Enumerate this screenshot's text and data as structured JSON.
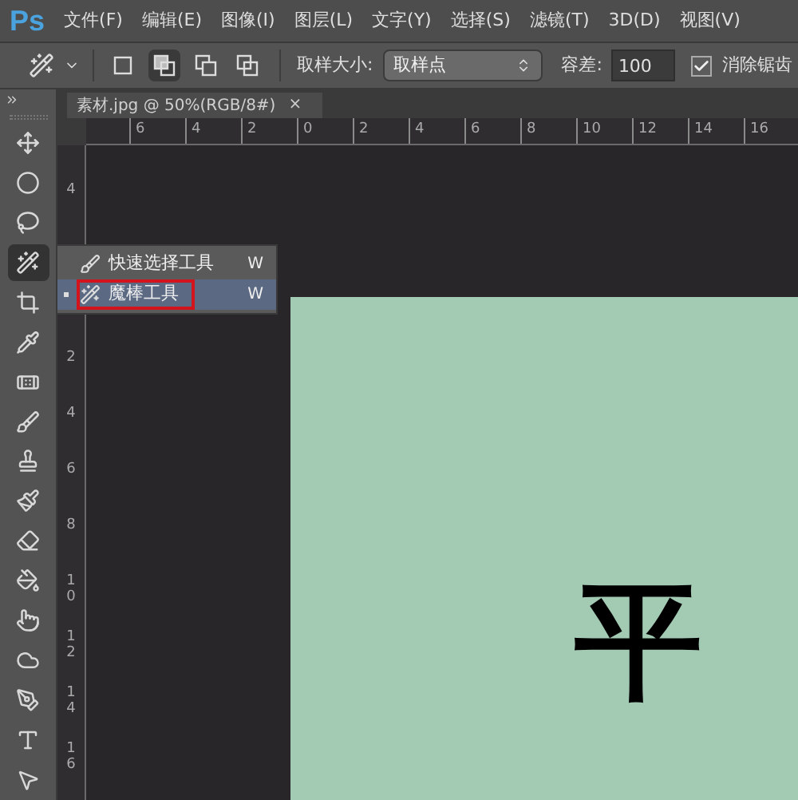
{
  "menu_bar": {
    "logo": "Ps",
    "items": [
      "文件(F)",
      "编辑(E)",
      "图像(I)",
      "图层(L)",
      "文字(Y)",
      "选择(S)",
      "滤镜(T)",
      "3D(D)",
      "视图(V)"
    ]
  },
  "options_bar": {
    "modes": [
      {
        "selected": false
      },
      {
        "selected": true
      },
      {
        "selected": false
      },
      {
        "selected": false
      }
    ],
    "sample_size": {
      "label": "取样大小:",
      "value": "取样点"
    },
    "tolerance": {
      "label": "容差:",
      "value": "100"
    },
    "anti_alias": {
      "label": "消除锯齿",
      "checked": true
    }
  },
  "tools": [
    {
      "kind": "move",
      "selected": false
    },
    {
      "kind": "marquee",
      "selected": false
    },
    {
      "kind": "lasso",
      "selected": false
    },
    {
      "kind": "wand",
      "selected": true
    },
    {
      "kind": "crop",
      "selected": false
    },
    {
      "kind": "eyedropper",
      "selected": false
    },
    {
      "kind": "healing",
      "selected": false
    },
    {
      "kind": "brush",
      "selected": false
    },
    {
      "kind": "stamp",
      "selected": false
    },
    {
      "kind": "history",
      "selected": false
    },
    {
      "kind": "eraser",
      "selected": false
    },
    {
      "kind": "bucket",
      "selected": false
    },
    {
      "kind": "smudge",
      "selected": false
    },
    {
      "kind": "sponge",
      "selected": false
    },
    {
      "kind": "pen",
      "selected": false
    },
    {
      "kind": "type",
      "selected": false
    },
    {
      "kind": "path",
      "selected": false
    }
  ],
  "flyout": [
    {
      "kind": "quick",
      "label": "快速选择工具",
      "shortcut": "W",
      "selected": false,
      "annotated": false
    },
    {
      "kind": "wand",
      "label": "魔棒工具",
      "shortcut": "W",
      "selected": true,
      "annotated": true
    }
  ],
  "document_tab": {
    "title": "素材.jpg @ 50%(RGB/8#)",
    "close": "×"
  },
  "top_ruler": [
    "6",
    "4",
    "2",
    "0",
    "2",
    "4",
    "6",
    "8",
    "10",
    "12",
    "14",
    "16"
  ],
  "left_ruler": {
    "upper": [
      "4"
    ],
    "lower": [
      "2",
      "4",
      "6",
      "8",
      "10",
      "12",
      "14",
      "16"
    ]
  },
  "canvas_text": "平"
}
